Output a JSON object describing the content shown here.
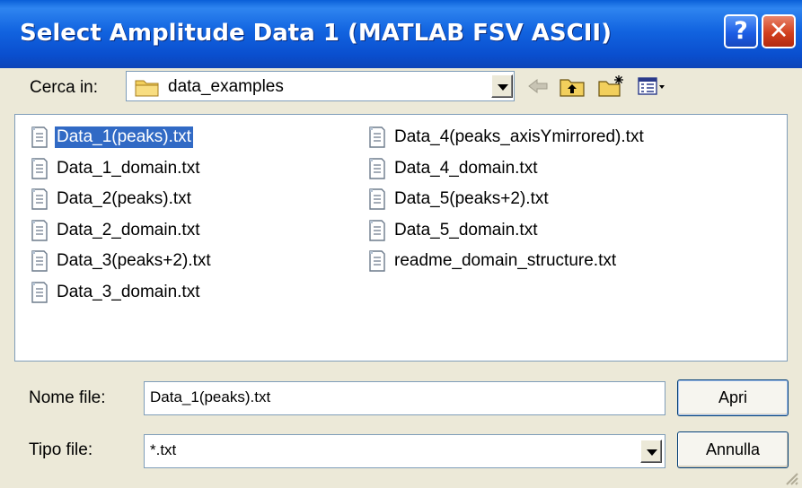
{
  "window": {
    "title": "Select Amplitude Data 1 (MATLAB FSV ASCII)"
  },
  "titlebar": {
    "help_label": "?",
    "close_label": "✕"
  },
  "look_in": {
    "label": "Cerca in:",
    "folder": "data_examples",
    "folder_icon": "folder-icon"
  },
  "toolbar": {
    "icons": [
      "back-arrow-icon",
      "up-folder-icon",
      "new-folder-icon",
      "view-menu-icon"
    ]
  },
  "files": {
    "column1": [
      {
        "name": "Data_1(peaks).txt",
        "selected": true
      },
      {
        "name": "Data_1_domain.txt"
      },
      {
        "name": "Data_2(peaks).txt"
      },
      {
        "name": "Data_2_domain.txt"
      },
      {
        "name": "Data_3(peaks+2).txt"
      },
      {
        "name": "Data_3_domain.txt"
      }
    ],
    "column2": [
      {
        "name": "Data_4(peaks_axisYmirrored).txt"
      },
      {
        "name": "Data_4_domain.txt"
      },
      {
        "name": "Data_5(peaks+2).txt"
      },
      {
        "name": "Data_5_domain.txt"
      },
      {
        "name": "readme_domain_structure.txt"
      }
    ]
  },
  "filename": {
    "label": "Nome file:",
    "value": "Data_1(peaks).txt"
  },
  "filetype": {
    "label": "Tipo file:",
    "value": "*.txt"
  },
  "buttons": {
    "open": "Apri",
    "cancel": "Annulla"
  },
  "colors": {
    "titlebar": "#0a4fcf",
    "selection": "#316ac5",
    "face": "#ece9d8"
  }
}
